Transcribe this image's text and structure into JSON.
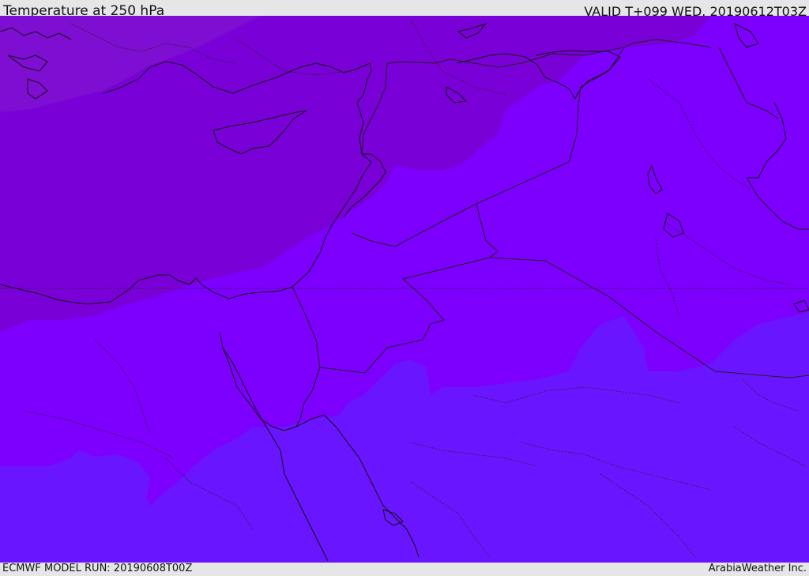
{
  "header": {
    "title": "Temperature at 250 hPa",
    "valid": "VALID T+099 WED. 20190612T03Z"
  },
  "footer": {
    "model_run": "ECMWF MODEL RUN: 20190608T00Z",
    "credit": "ArabiaWeather Inc."
  },
  "map": {
    "variable": "temperature",
    "pressure_level_hpa": 250,
    "colors": {
      "band_warmest": "#6a15ff",
      "band_warm": "#7d00ff",
      "band_cool": "#7a00d8",
      "band_coolest": "#7e0ed2",
      "coastline": "#111111",
      "border": "#202020"
    }
  }
}
